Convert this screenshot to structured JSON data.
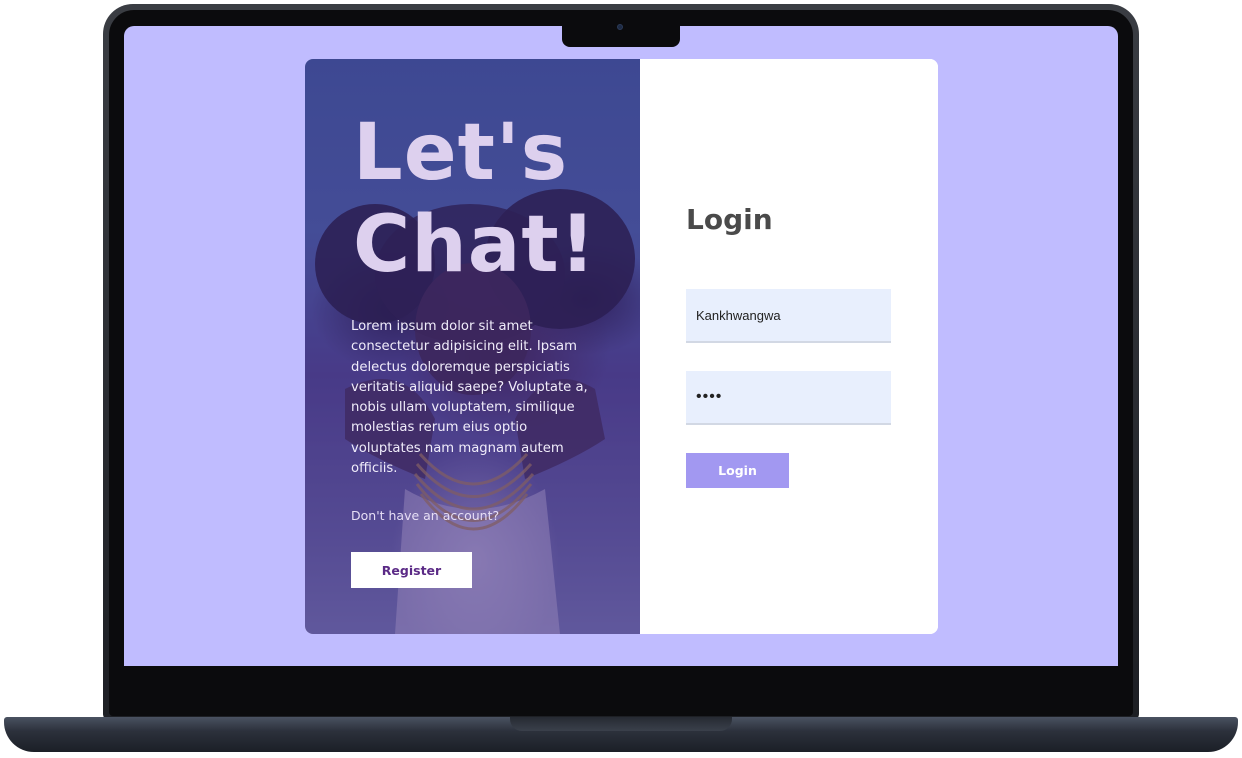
{
  "hero": {
    "title_line1": "Let's",
    "title_line2": "Chat!",
    "description": "Lorem ipsum dolor sit amet consectetur adipisicing elit. Ipsam delectus doloremque perspiciatis veritatis aliquid saepe? Voluptate a, nobis ullam voluptatem, similique molestias rerum eius optio voluptates nam magnam autem officiis.",
    "account_question": "Don't have an account?",
    "register_label": "Register"
  },
  "login": {
    "title": "Login",
    "username_value": "Kankhwangwa",
    "password_value": "••••",
    "button_label": "Login"
  },
  "colors": {
    "screen_background": "#c0bcff",
    "login_button": "#a298f1",
    "input_background": "#e8effd",
    "register_text": "#5b2a86"
  }
}
